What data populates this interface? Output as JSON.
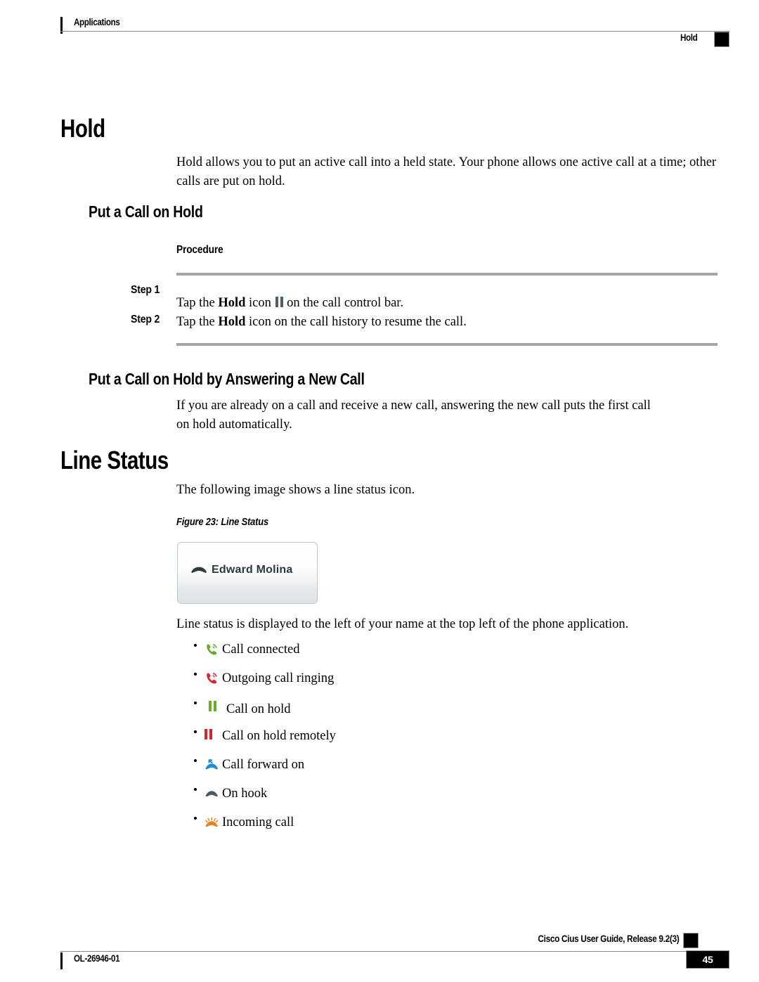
{
  "header": {
    "left": "Applications",
    "right": "Hold"
  },
  "sections": {
    "hold": {
      "title": "Hold",
      "intro": "Hold allows you to put an active call into a held state. Your phone allows one active call at a time; other calls are put on hold.",
      "put_on_hold": {
        "title": "Put a Call on Hold",
        "procedure_label": "Procedure",
        "steps": [
          {
            "label": "Step 1",
            "text_before": "Tap the ",
            "bold": "Hold",
            "text_mid": " icon ",
            "icon": "pause-icon",
            "text_after": " on the call control bar."
          },
          {
            "label": "Step 2",
            "text_before": "Tap the ",
            "bold": "Hold",
            "text_mid": " icon on the call history to resume the call.",
            "icon": "",
            "text_after": ""
          }
        ]
      },
      "answer_new_call": {
        "title": "Put a Call on Hold by Answering a New Call",
        "body": "If you are already on a call and receive a new call, answering the new call puts the first call on hold automatically."
      }
    },
    "line_status": {
      "title": "Line Status",
      "intro": "The following image shows a line status icon.",
      "figure_caption": "Figure 23: Line Status",
      "figure": {
        "name": "Edward Molina",
        "icon": "on-hook-handset-icon"
      },
      "body": "Line status is displayed to the left of your name at the top left of the phone application.",
      "items": [
        {
          "label": "Call connected",
          "icon": "handset-ringing-icon",
          "color": "#6aab2b"
        },
        {
          "label": "Outgoing call ringing",
          "icon": "handset-ringing-icon",
          "color": "#d8232a"
        },
        {
          "label": "Call on hold",
          "icon": "pause-icon",
          "color": "#6aab2b"
        },
        {
          "label": "Call on hold remotely",
          "icon": "pause-icon",
          "color": "#d8232a"
        },
        {
          "label": "Call forward on",
          "icon": "handset-forward-icon",
          "color": "#1a8fd6"
        },
        {
          "label": "On hook",
          "icon": "on-hook-handset-icon",
          "color": "#4a5a60"
        },
        {
          "label": "Incoming call",
          "icon": "handset-incoming-icon",
          "color": "#e8821e"
        }
      ]
    }
  },
  "footer": {
    "doc_id": "OL-26946-01",
    "guide_title": "Cisco Cius User Guide, Release 9.2(3)",
    "page_number": "45"
  },
  "colors": {
    "hold_icon": "#4d6168",
    "green": "#6aab2b",
    "red": "#d8232a",
    "blue": "#1a8fd6",
    "orange": "#e8821e",
    "gray_handset": "#4a5a60",
    "rule": "#a6a6a6"
  }
}
